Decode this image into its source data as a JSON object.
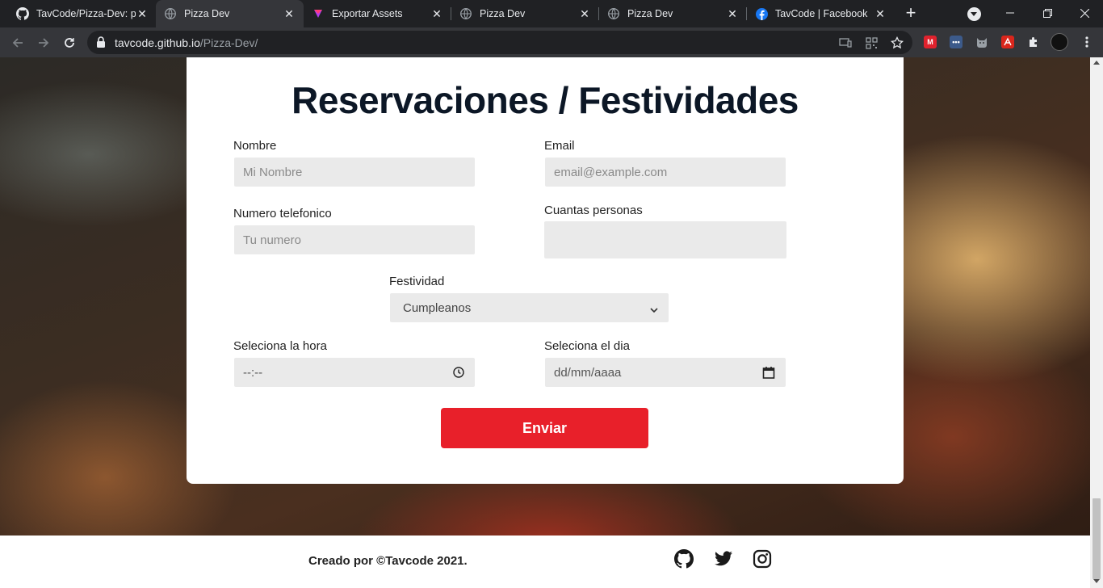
{
  "browser": {
    "tabs": [
      {
        "title": "TavCode/Pizza-Dev: pa",
        "icon": "github-icon",
        "active": false
      },
      {
        "title": "Pizza Dev",
        "icon": "globe-icon",
        "active": true
      },
      {
        "title": "Exportar Assets",
        "icon": "figma-icon",
        "active": false
      },
      {
        "title": "Pizza Dev",
        "icon": "globe-icon",
        "active": false
      },
      {
        "title": "Pizza Dev",
        "icon": "globe-icon",
        "active": false
      },
      {
        "title": "TavCode | Facebook",
        "icon": "facebook-icon",
        "active": false
      }
    ],
    "url_host": "tavcode.github.io",
    "url_path": "/Pizza-Dev/"
  },
  "form": {
    "title": "Reservaciones / Festividades",
    "name_label": "Nombre",
    "name_placeholder": "Mi Nombre",
    "email_label": "Email",
    "email_placeholder": "email@example.com",
    "phone_label": "Numero telefonico",
    "phone_placeholder": "Tu numero",
    "people_label": "Cuantas personas",
    "people_value": "",
    "festivity_label": "Festividad",
    "festivity_value": "Cumpleanos",
    "time_label": "Seleciona la hora",
    "time_placeholder": "--:--",
    "date_label": "Seleciona el dia",
    "date_placeholder": "dd/mm/aaaa",
    "submit_label": "Enviar"
  },
  "footer": {
    "credit": "Creado por ©Tavcode 2021.",
    "socials": [
      "github-icon",
      "twitter-icon",
      "instagram-icon"
    ]
  },
  "colors": {
    "accent": "#e8202a",
    "title": "#0c1726",
    "input_bg": "#eaeaea"
  }
}
